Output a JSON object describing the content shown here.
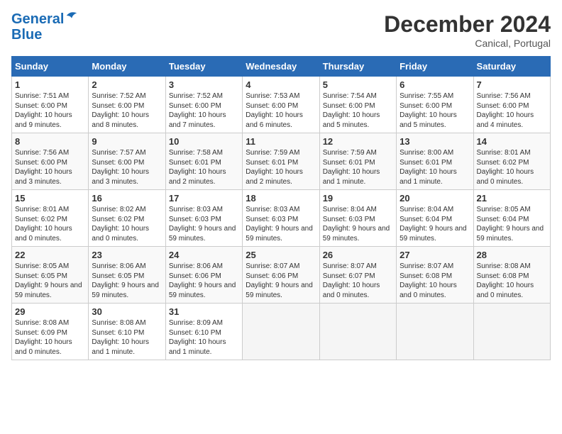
{
  "header": {
    "logo_line1": "General",
    "logo_line2": "Blue",
    "month": "December 2024",
    "location": "Canical, Portugal"
  },
  "weekdays": [
    "Sunday",
    "Monday",
    "Tuesday",
    "Wednesday",
    "Thursday",
    "Friday",
    "Saturday"
  ],
  "weeks": [
    [
      {
        "day": 1,
        "sunrise": "7:51 AM",
        "sunset": "6:00 PM",
        "daylight": "10 hours and 9 minutes."
      },
      {
        "day": 2,
        "sunrise": "7:52 AM",
        "sunset": "6:00 PM",
        "daylight": "10 hours and 8 minutes."
      },
      {
        "day": 3,
        "sunrise": "7:52 AM",
        "sunset": "6:00 PM",
        "daylight": "10 hours and 7 minutes."
      },
      {
        "day": 4,
        "sunrise": "7:53 AM",
        "sunset": "6:00 PM",
        "daylight": "10 hours and 6 minutes."
      },
      {
        "day": 5,
        "sunrise": "7:54 AM",
        "sunset": "6:00 PM",
        "daylight": "10 hours and 5 minutes."
      },
      {
        "day": 6,
        "sunrise": "7:55 AM",
        "sunset": "6:00 PM",
        "daylight": "10 hours and 5 minutes."
      },
      {
        "day": 7,
        "sunrise": "7:56 AM",
        "sunset": "6:00 PM",
        "daylight": "10 hours and 4 minutes."
      }
    ],
    [
      {
        "day": 8,
        "sunrise": "7:56 AM",
        "sunset": "6:00 PM",
        "daylight": "10 hours and 3 minutes."
      },
      {
        "day": 9,
        "sunrise": "7:57 AM",
        "sunset": "6:00 PM",
        "daylight": "10 hours and 3 minutes."
      },
      {
        "day": 10,
        "sunrise": "7:58 AM",
        "sunset": "6:01 PM",
        "daylight": "10 hours and 2 minutes."
      },
      {
        "day": 11,
        "sunrise": "7:59 AM",
        "sunset": "6:01 PM",
        "daylight": "10 hours and 2 minutes."
      },
      {
        "day": 12,
        "sunrise": "7:59 AM",
        "sunset": "6:01 PM",
        "daylight": "10 hours and 1 minute."
      },
      {
        "day": 13,
        "sunrise": "8:00 AM",
        "sunset": "6:01 PM",
        "daylight": "10 hours and 1 minute."
      },
      {
        "day": 14,
        "sunrise": "8:01 AM",
        "sunset": "6:02 PM",
        "daylight": "10 hours and 0 minutes."
      }
    ],
    [
      {
        "day": 15,
        "sunrise": "8:01 AM",
        "sunset": "6:02 PM",
        "daylight": "10 hours and 0 minutes."
      },
      {
        "day": 16,
        "sunrise": "8:02 AM",
        "sunset": "6:02 PM",
        "daylight": "10 hours and 0 minutes."
      },
      {
        "day": 17,
        "sunrise": "8:03 AM",
        "sunset": "6:03 PM",
        "daylight": "9 hours and 59 minutes."
      },
      {
        "day": 18,
        "sunrise": "8:03 AM",
        "sunset": "6:03 PM",
        "daylight": "9 hours and 59 minutes."
      },
      {
        "day": 19,
        "sunrise": "8:04 AM",
        "sunset": "6:03 PM",
        "daylight": "9 hours and 59 minutes."
      },
      {
        "day": 20,
        "sunrise": "8:04 AM",
        "sunset": "6:04 PM",
        "daylight": "9 hours and 59 minutes."
      },
      {
        "day": 21,
        "sunrise": "8:05 AM",
        "sunset": "6:04 PM",
        "daylight": "9 hours and 59 minutes."
      }
    ],
    [
      {
        "day": 22,
        "sunrise": "8:05 AM",
        "sunset": "6:05 PM",
        "daylight": "9 hours and 59 minutes."
      },
      {
        "day": 23,
        "sunrise": "8:06 AM",
        "sunset": "6:05 PM",
        "daylight": "9 hours and 59 minutes."
      },
      {
        "day": 24,
        "sunrise": "8:06 AM",
        "sunset": "6:06 PM",
        "daylight": "9 hours and 59 minutes."
      },
      {
        "day": 25,
        "sunrise": "8:07 AM",
        "sunset": "6:06 PM",
        "daylight": "9 hours and 59 minutes."
      },
      {
        "day": 26,
        "sunrise": "8:07 AM",
        "sunset": "6:07 PM",
        "daylight": "10 hours and 0 minutes."
      },
      {
        "day": 27,
        "sunrise": "8:07 AM",
        "sunset": "6:08 PM",
        "daylight": "10 hours and 0 minutes."
      },
      {
        "day": 28,
        "sunrise": "8:08 AM",
        "sunset": "6:08 PM",
        "daylight": "10 hours and 0 minutes."
      }
    ],
    [
      {
        "day": 29,
        "sunrise": "8:08 AM",
        "sunset": "6:09 PM",
        "daylight": "10 hours and 0 minutes."
      },
      {
        "day": 30,
        "sunrise": "8:08 AM",
        "sunset": "6:10 PM",
        "daylight": "10 hours and 1 minute."
      },
      {
        "day": 31,
        "sunrise": "8:09 AM",
        "sunset": "6:10 PM",
        "daylight": "10 hours and 1 minute."
      },
      null,
      null,
      null,
      null
    ]
  ]
}
